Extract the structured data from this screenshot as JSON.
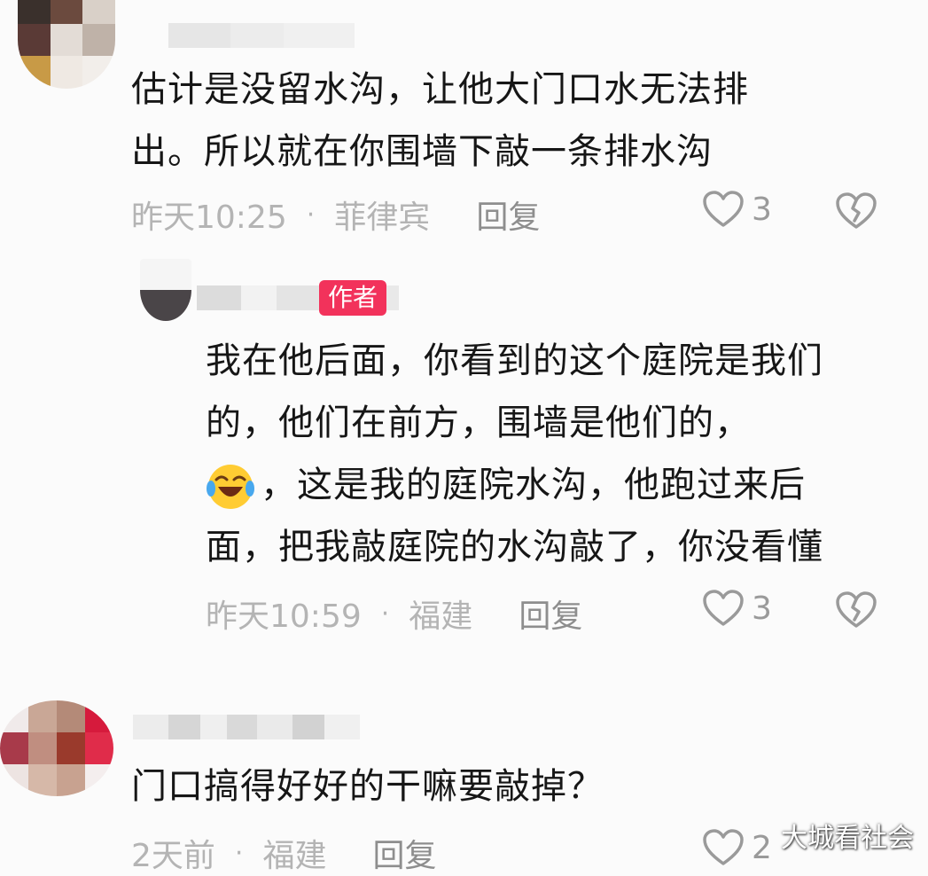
{
  "comments": [
    {
      "text_lines": [
        "估计是没留水沟，让他大门口水无法排",
        "出。所以就在你围墙下敲一条排水沟"
      ],
      "time": "昨天10:25",
      "location": "菲律宾",
      "reply_label": "回复",
      "likes": "3"
    },
    {
      "author_badge": "作者",
      "text_lines": [
        "我在他后面，你看到的这个庭院是我们",
        "的，他们在前方，围墙是他们的，",
        "，这是我的庭院水沟，他跑过来后",
        "面，把我敲庭院的水沟敲了，你没看懂"
      ],
      "time": "昨天10:59",
      "location": "福建",
      "reply_label": "回复",
      "likes": "3"
    },
    {
      "text_lines": [
        "门口搞得好好的干嘛要敲掉？"
      ],
      "time": "2天前",
      "location": "福建",
      "reply_label": "回复",
      "likes": "2"
    }
  ],
  "separator": "·",
  "icons": {
    "like": "heart-outline-icon",
    "dislike": "broken-heart-icon",
    "emoji": "laughing-tears-emoji"
  },
  "colors": {
    "badge": "#f2325b",
    "meta": "#b4b4b4",
    "reply": "#8e8e8e"
  },
  "watermark": "大城看社会"
}
